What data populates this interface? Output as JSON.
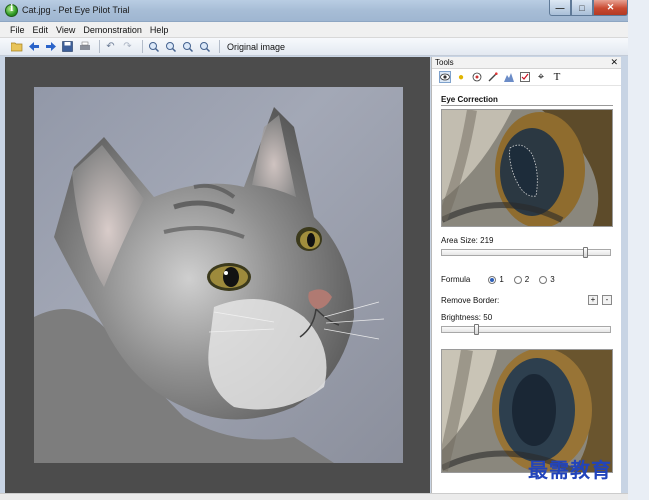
{
  "window": {
    "title": "Cat.jpg - Pet Eye Pilot Trial"
  },
  "menu": [
    "File",
    "Edit",
    "View",
    "Demonstration",
    "Help"
  ],
  "toolbar": {
    "original_label": "Original image"
  },
  "tools_panel": {
    "title": "Tools",
    "section": "Eye Correction",
    "area_size_label": "Area Size: 219",
    "area_size_value": 219,
    "formula_label": "Formula",
    "formula_options": [
      "1",
      "2",
      "3"
    ],
    "formula_selected": "1",
    "remove_border_label": "Remove Border:",
    "brightness_label": "Brightness: 50",
    "brightness_value": 50
  },
  "watermark": "最需教育",
  "colors": {
    "close_button": "#c94a31",
    "accent": "#2d5fb8"
  }
}
